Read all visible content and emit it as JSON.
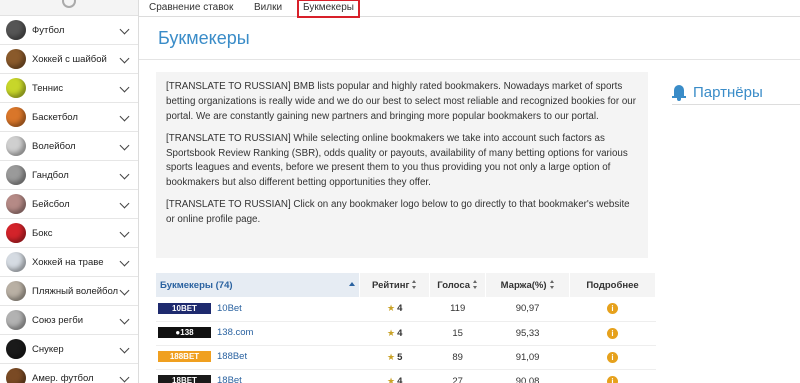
{
  "sidebar": {
    "items": [
      {
        "label": "Футбол",
        "icon": "football-icon",
        "color": "#555555"
      },
      {
        "label": "Хоккей с шайбой",
        "icon": "hockey-icon",
        "color": "#8a5a2b"
      },
      {
        "label": "Теннис",
        "icon": "tennis-icon",
        "color": "#c7d62a"
      },
      {
        "label": "Баскетбол",
        "icon": "basketball-icon",
        "color": "#d9762a"
      },
      {
        "label": "Волейбол",
        "icon": "volleyball-icon",
        "color": "#cfcfcf"
      },
      {
        "label": "Гандбол",
        "icon": "handball-icon",
        "color": "#9a9a9a"
      },
      {
        "label": "Бейсбол",
        "icon": "baseball-icon",
        "color": "#b58a86"
      },
      {
        "label": "Бокс",
        "icon": "boxing-icon",
        "color": "#d3232a"
      },
      {
        "label": "Хоккей на траве",
        "icon": "field-hockey-icon",
        "color": "#d5dbe2"
      },
      {
        "label": "Пляжный волейбол",
        "icon": "beach-volleyball-icon",
        "color": "#b9b0a4"
      },
      {
        "label": "Союз регби",
        "icon": "rugby-icon",
        "color": "#b2b2b2"
      },
      {
        "label": "Снукер",
        "icon": "snooker-icon",
        "color": "#1a1a1a"
      },
      {
        "label": "Амер. футбол",
        "icon": "american-football-icon",
        "color": "#7a4a24"
      }
    ]
  },
  "tabs": [
    {
      "label": "Сравнение ставок",
      "active": false
    },
    {
      "label": "Вилки",
      "active": false
    },
    {
      "label": "Букмекеры",
      "active": true
    }
  ],
  "page": {
    "title": "Букмекеры",
    "paragraphs": [
      "[TRANSLATE TO RUSSIAN] BMB lists popular and highly rated bookmakers. Nowadays market of sports betting organizations is really wide and we do our best to select most reliable and recognized bookies for our portal. We are constantly gaining new partners and bringing more popular bookmakers to our portal.",
      "[TRANSLATE TO RUSSIAN] While selecting online bookmakers we take into account such factors as Sportsbook Review Ranking (SBR), odds quality or payouts, availability of many betting options for various sports leagues and events, before we present them to you thus providing you not only a large option of bookmakers but also different betting opportunities they offer.",
      "[TRANSLATE TO RUSSIAN] Click on any bookmaker logo below to go directly to that bookmaker's website or online profile page."
    ]
  },
  "partners": {
    "label": "Партнёры",
    "icon": "bell-icon",
    "accent": "#3a8cc8"
  },
  "table": {
    "headers": {
      "name": "Букмекеры (74)",
      "rating": "Рейтинг",
      "votes": "Голоса",
      "margin": "Маржа(%)",
      "more": "Подробнее"
    },
    "rows": [
      {
        "name": "10Bet",
        "logo_text": "10BET",
        "logo_color": "#1e2a6e",
        "rating": "4",
        "votes": "119",
        "margin": "90,97"
      },
      {
        "name": "138.com",
        "logo_text": "●138",
        "logo_color": "#111111",
        "rating": "4",
        "votes": "15",
        "margin": "95,33"
      },
      {
        "name": "188Bet",
        "logo_text": "188BET",
        "logo_color": "#f0a020",
        "rating": "5",
        "votes": "89",
        "margin": "91,09"
      },
      {
        "name": "18Bet",
        "logo_text": "18BET",
        "logo_color": "#1a1a1a",
        "rating": "4",
        "votes": "27",
        "margin": "90,08"
      }
    ]
  }
}
